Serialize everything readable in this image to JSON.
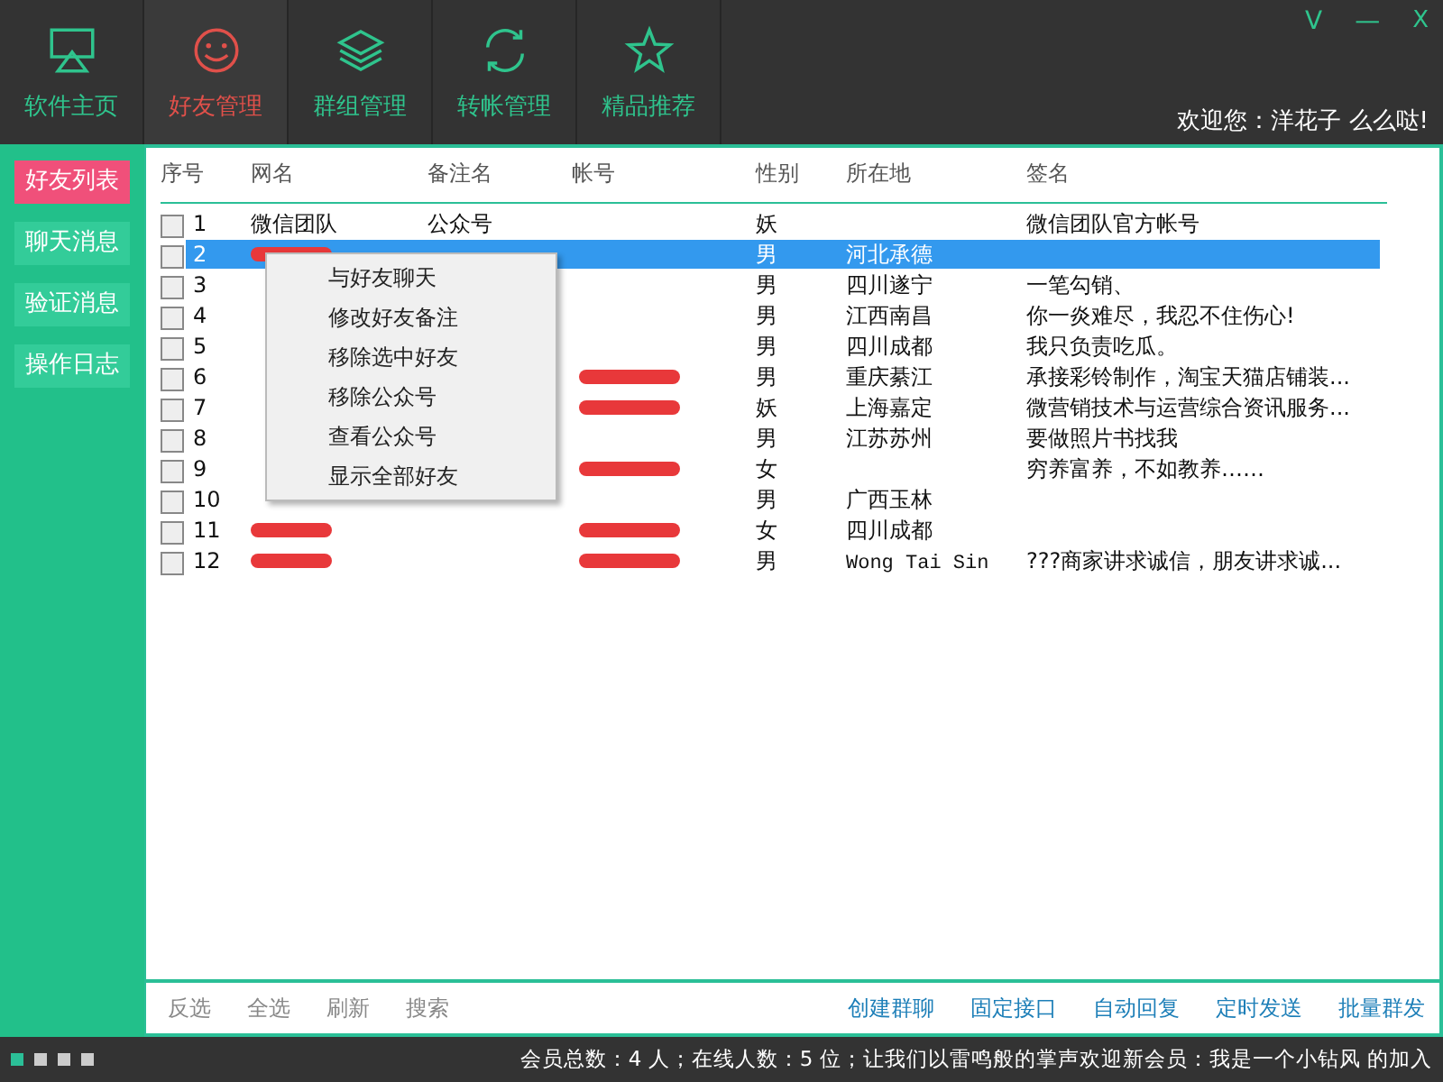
{
  "nav_tabs": [
    {
      "label": "软件主页",
      "kind": "screen",
      "selected": false
    },
    {
      "label": "好友管理",
      "kind": "smile",
      "selected": true
    },
    {
      "label": "群组管理",
      "kind": "layers",
      "selected": false
    },
    {
      "label": "转帐管理",
      "kind": "sync",
      "selected": false
    },
    {
      "label": "精品推荐",
      "kind": "star",
      "selected": false
    }
  ],
  "window_controls": [
    {
      "label": "V",
      "kind": "skin"
    },
    {
      "label": "—",
      "kind": "min"
    },
    {
      "label": "X",
      "kind": "close"
    }
  ],
  "welcome": "欢迎您：洋花子 么么哒!",
  "sidebar": {
    "items": [
      {
        "label": "好友列表",
        "selected": true
      },
      {
        "label": "聊天消息",
        "selected": false
      },
      {
        "label": "验证消息",
        "selected": false
      },
      {
        "label": "操作日志",
        "selected": false
      }
    ]
  },
  "table": {
    "columns": [
      "序号",
      "网名",
      "备注名",
      "帐号",
      "性别",
      "所在地",
      "签名"
    ],
    "rows": [
      {
        "no": "1",
        "name": "微信团队",
        "remark": "公众号",
        "gender": "妖",
        "signature": "微信团队官方帐号",
        "checked": false,
        "selected": false
      },
      {
        "no": "2",
        "gender": "男",
        "location": "河北承德",
        "checked": false,
        "selected": true,
        "name_hidden": true
      },
      {
        "no": "3",
        "gender": "男",
        "location": "四川遂宁",
        "signature": "一笔勾销、",
        "checked": false,
        "selected": false
      },
      {
        "no": "4",
        "gender": "男",
        "location": "江西南昌",
        "signature": "你一炎难尽，我忍不住伤心!",
        "checked": false,
        "selected": false
      },
      {
        "no": "5",
        "gender": "男",
        "location": "四川成都",
        "signature": "我只负责吃瓜。",
        "checked": false,
        "selected": false
      },
      {
        "no": "6",
        "gender": "男",
        "location": "重庆綦江",
        "signature": "承接彩铃制作，淘宝天猫店铺装...",
        "checked": false,
        "selected": false,
        "account_hidden": true
      },
      {
        "no": "7",
        "gender": "妖",
        "location": "上海嘉定",
        "signature": "微营销技术与运营综合资讯服务...",
        "checked": false,
        "selected": false,
        "account_hidden": true
      },
      {
        "no": "8",
        "gender": "男",
        "location": "江苏苏州",
        "signature": "要做照片书找我",
        "checked": false,
        "selected": false
      },
      {
        "no": "9",
        "gender": "女",
        "signature": "穷养富养，不如教养……",
        "checked": false,
        "selected": false,
        "account_hidden": true
      },
      {
        "no": "10",
        "gender": "男",
        "location": "广西玉林",
        "checked": false,
        "selected": false
      },
      {
        "no": "11",
        "gender": "女",
        "location": "四川成都",
        "checked": false,
        "selected": false,
        "name_hidden": true,
        "account_hidden": true
      },
      {
        "no": "12",
        "gender": "男",
        "location": "Wong Tai Sin",
        "signature": "???商家讲求诚信，朋友讲求诚...",
        "checked": false,
        "selected": false,
        "name_hidden": true,
        "account_hidden": true
      }
    ]
  },
  "context_menu": [
    "与好友聊天",
    "修改好友备注",
    "移除选中好友",
    "移除公众号",
    "查看公众号",
    "显示全部好友"
  ],
  "toolbar": {
    "left": [
      "反选",
      "全选",
      "刷新",
      "搜索"
    ],
    "right": [
      "创建群聊",
      "固定接口",
      "自动回复",
      "定时发送",
      "批量群发"
    ]
  },
  "status_bar": {
    "text": "会员总数：4 人；在线人数：5 位；让我们以雷鸣般的掌声欢迎新会员：我是一个小钻风 的加入"
  }
}
